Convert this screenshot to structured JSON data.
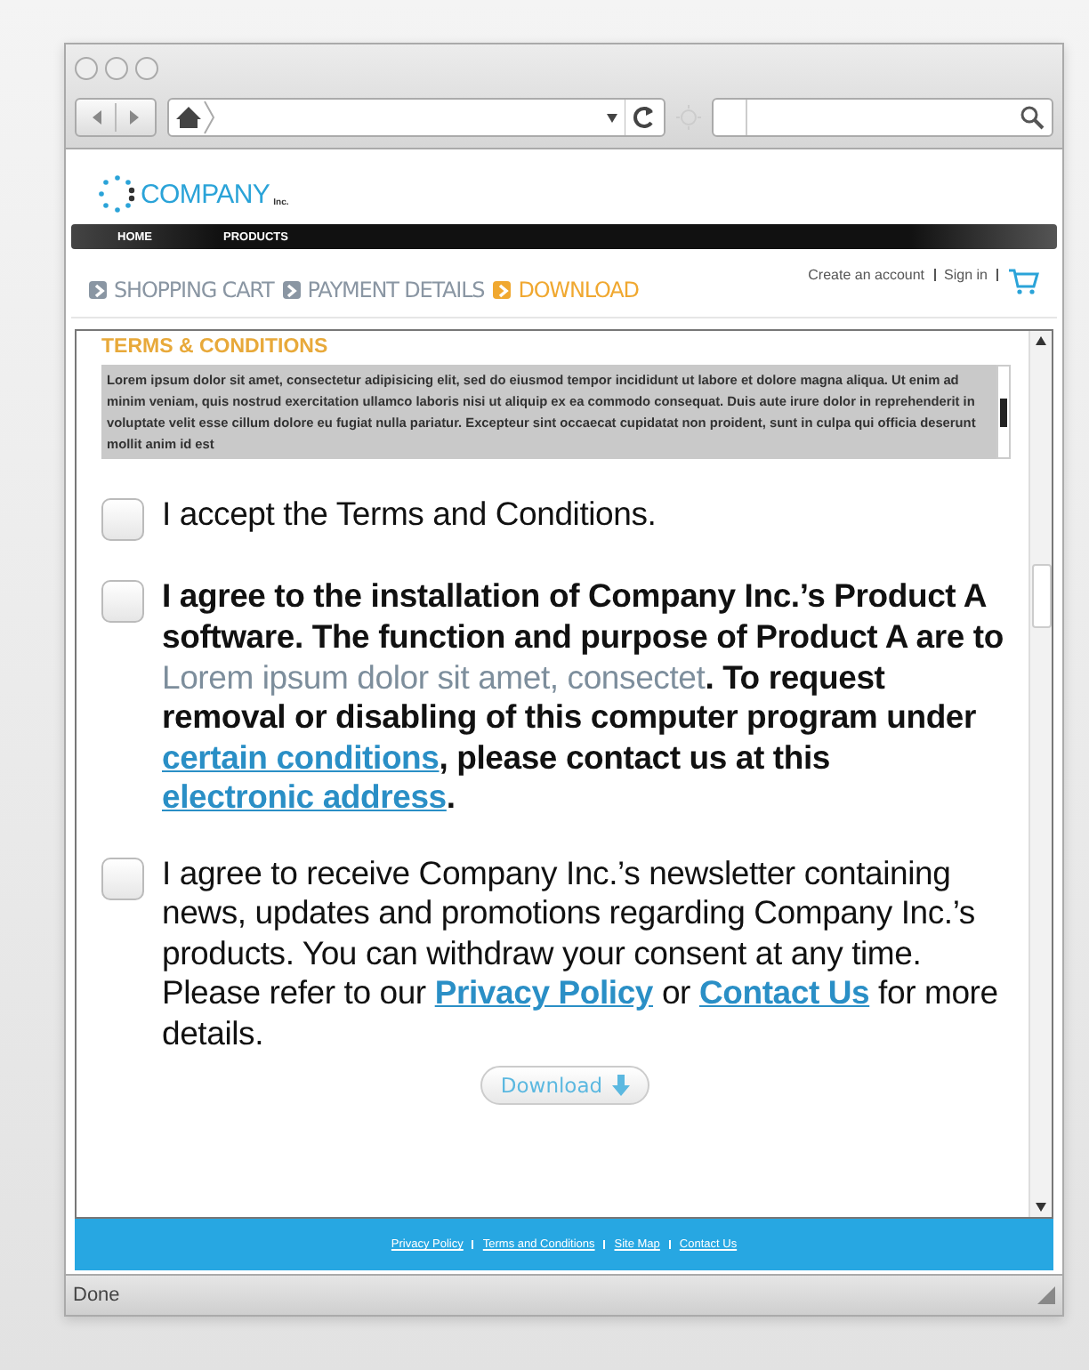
{
  "browser": {
    "status": "Done"
  },
  "logo": {
    "name": "COMPANY",
    "suffix": "Inc."
  },
  "nav": [
    "HOME",
    "PRODUCTS"
  ],
  "steps": [
    {
      "label": "SHOPPING CART",
      "selected": false
    },
    {
      "label": "PAYMENT DETAILS",
      "selected": false
    },
    {
      "label": "DOWNLOAD",
      "selected": true
    }
  ],
  "account_links": [
    "Create an account",
    "Sign in"
  ],
  "terms": {
    "title": "TERMS & CONDITIONS",
    "text": "Lorem ipsum dolor sit amet, consectetur adipisicing elit, sed do eiusmod tempor incididunt ut labore et dolore magna aliqua. Ut enim ad minim veniam, quis nostrud exercitation ullamco laboris nisi ut aliquip ex ea commodo consequat. Duis aute irure dolor in reprehenderit in voluptate velit esse cillum dolore eu fugiat nulla pariatur. Excepteur sint occaecat cupidatat non proident, sunt in culpa qui officia deserunt mollit anim id est"
  },
  "agreements": [
    {
      "checked": false,
      "bold": false,
      "parts": [
        {
          "kind": "text",
          "text": "I accept the Terms and Conditions."
        }
      ]
    },
    {
      "checked": false,
      "bold": true,
      "parts": [
        {
          "kind": "text",
          "text": "I agree to the installation of Company Inc.’s Product A software. The function and purpose of Product A are to "
        },
        {
          "kind": "blurred",
          "text": "Lorem ipsum dolor sit amet, consectet"
        },
        {
          "kind": "text",
          "text": ". To request removal or disabling of this computer program under "
        },
        {
          "kind": "link",
          "text": "certain conditions"
        },
        {
          "kind": "text",
          "text": ", please contact us at this "
        },
        {
          "kind": "link",
          "text": "electronic address"
        },
        {
          "kind": "text",
          "text": "."
        }
      ]
    },
    {
      "checked": false,
      "bold": false,
      "parts": [
        {
          "kind": "text",
          "text": "I agree to receive Company Inc.’s newsletter containing news, updates and promotions regarding Company Inc.’s products. You can withdraw your consent at any time. Please refer to our "
        },
        {
          "kind": "boldlink",
          "text": "Privacy Policy"
        },
        {
          "kind": "text",
          "text": " or "
        },
        {
          "kind": "boldlink",
          "text": "Contact Us"
        },
        {
          "kind": "text",
          "text": " for more details."
        }
      ]
    }
  ],
  "download_button": "Download",
  "footer_links": [
    "Privacy Policy",
    "Terms and Conditions",
    "Site Map",
    "Contact Us"
  ]
}
